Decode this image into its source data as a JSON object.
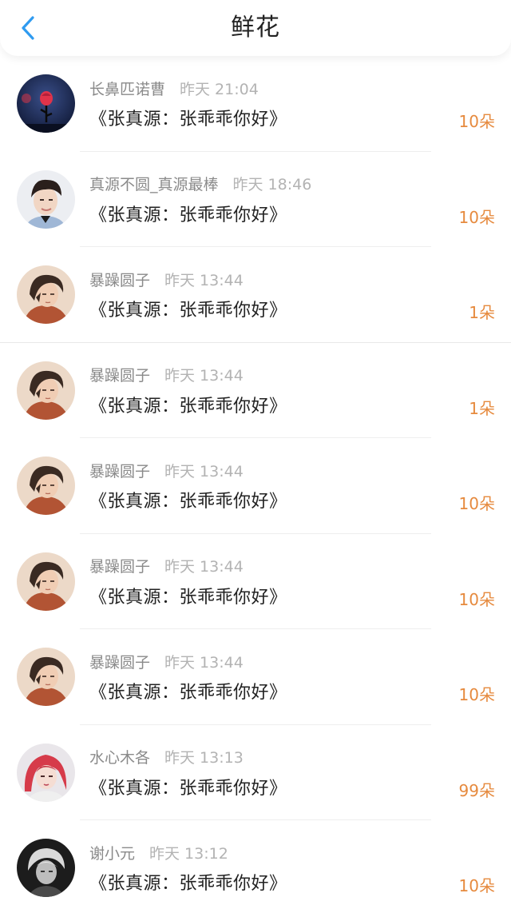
{
  "header": {
    "title": "鲜花",
    "back_icon": "chevron-left-icon",
    "accent_color": "#2f9bf0"
  },
  "colors": {
    "amount": "#e68a3e",
    "name": "#8a8a8a",
    "time": "#b3b3b3"
  },
  "gifts": [
    {
      "name": "长鼻匹诺曹",
      "time": "昨天 21:04",
      "message": "《张真源：张乖乖你好》",
      "amount": "10朵",
      "avatar": "rose-avatar"
    },
    {
      "name": "真源不圆_真源最棒",
      "time": "昨天 18:46",
      "message": "《张真源：张乖乖你好》",
      "amount": "10朵",
      "avatar": "boy-photo-avatar"
    },
    {
      "name": "暴躁圆子",
      "time": "昨天 13:44",
      "message": "《张真源：张乖乖你好》",
      "amount": "1朵",
      "avatar": "illustrated-portrait-avatar"
    },
    {
      "name": "暴躁圆子",
      "time": "昨天 13:44",
      "message": "《张真源：张乖乖你好》",
      "amount": "1朵",
      "avatar": "illustrated-portrait-avatar"
    },
    {
      "name": "暴躁圆子",
      "time": "昨天 13:44",
      "message": "《张真源：张乖乖你好》",
      "amount": "10朵",
      "avatar": "illustrated-portrait-avatar"
    },
    {
      "name": "暴躁圆子",
      "time": "昨天 13:44",
      "message": "《张真源：张乖乖你好》",
      "amount": "10朵",
      "avatar": "illustrated-portrait-avatar"
    },
    {
      "name": "暴躁圆子",
      "time": "昨天 13:44",
      "message": "《张真源：张乖乖你好》",
      "amount": "10朵",
      "avatar": "illustrated-portrait-avatar"
    },
    {
      "name": "水心木各",
      "time": "昨天 13:13",
      "message": "《张真源：张乖乖你好》",
      "amount": "99朵",
      "avatar": "red-hair-photo-avatar"
    },
    {
      "name": "谢小元",
      "time": "昨天 13:12",
      "message": "《张真源：张乖乖你好》",
      "amount": "10朵",
      "avatar": "bw-photo-avatar"
    }
  ]
}
